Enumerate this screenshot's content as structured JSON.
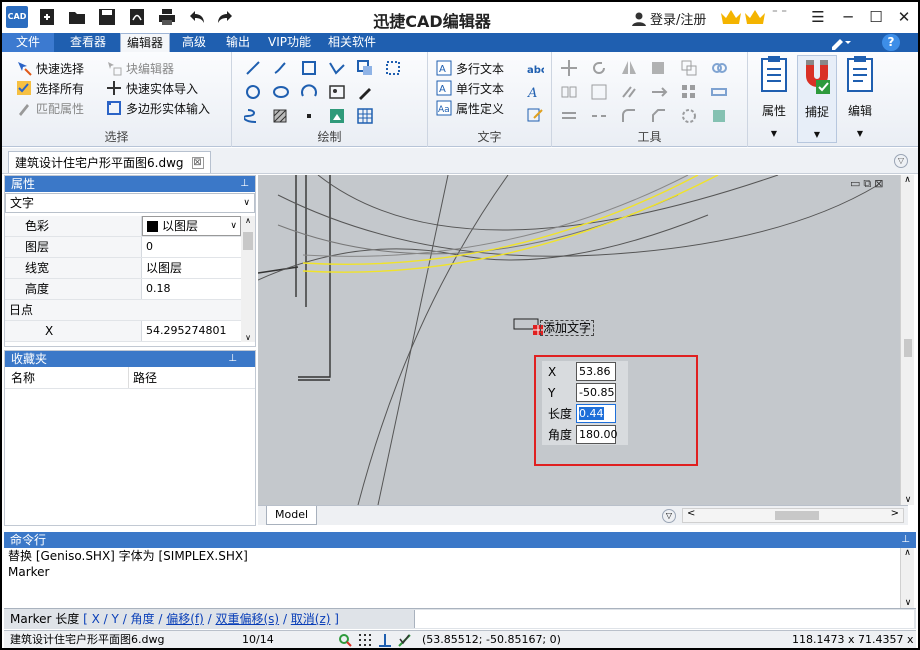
{
  "app": {
    "title": "迅捷CAD编辑器",
    "logo_text": "CAD",
    "login": "登录/注册"
  },
  "menu": {
    "tabs": [
      "文件",
      "查看器",
      "编辑器",
      "高级",
      "输出",
      "VIP功能",
      "相关软件"
    ],
    "active": "编辑器"
  },
  "ribbon": {
    "select": {
      "label": "选择",
      "items": [
        "快速选择",
        "选择所有",
        "匹配属性",
        "块编辑器",
        "快速实体导入",
        "多边形实体输入"
      ]
    },
    "draw": {
      "label": "绘制"
    },
    "text": {
      "label": "文字",
      "items": [
        "多行文本",
        "单行文本",
        "属性定义"
      ]
    },
    "tools": {
      "label": "工具"
    },
    "big": [
      "属性",
      "捕捉",
      "编辑"
    ]
  },
  "document": {
    "tab": "建筑设计住宅户形平面图6.dwg"
  },
  "properties": {
    "title": "属性",
    "selector": "文字",
    "rows": [
      {
        "k": "色彩",
        "v": "以图层"
      },
      {
        "k": "图层",
        "v": "0"
      },
      {
        "k": "线宽",
        "v": "以图层"
      },
      {
        "k": "高度",
        "v": "0.18"
      }
    ],
    "category": "日点",
    "xrow": {
      "k": "X",
      "v": "54.295274801"
    }
  },
  "favorites": {
    "title": "收藏夹",
    "col_name": "名称",
    "col_path": "路径"
  },
  "canvas": {
    "text_label": "添加文字",
    "model_tab": "Model"
  },
  "dynamic_input": {
    "rows": [
      {
        "k": "X",
        "v": "53.86"
      },
      {
        "k": "Y",
        "v": "-50.85"
      },
      {
        "k": "长度",
        "v": "0.44"
      },
      {
        "k": "角度",
        "v": "180.00"
      }
    ]
  },
  "command": {
    "title": "命令行",
    "history": [
      "替换 [Geniso.SHX] 字体为 [SIMPLEX.SHX]",
      "Marker"
    ],
    "prompt": "Marker  长度",
    "options": [
      "X",
      "Y",
      "角度",
      "偏移(f)",
      "双重偏移(s)",
      "取消(z)"
    ]
  },
  "status": {
    "file": "建筑设计住宅户形平面图6.dwg",
    "page": "10/14",
    "coords": "(53.85512; -50.85167; 0)",
    "size": "118.1473 x 71.4357 x 0"
  }
}
